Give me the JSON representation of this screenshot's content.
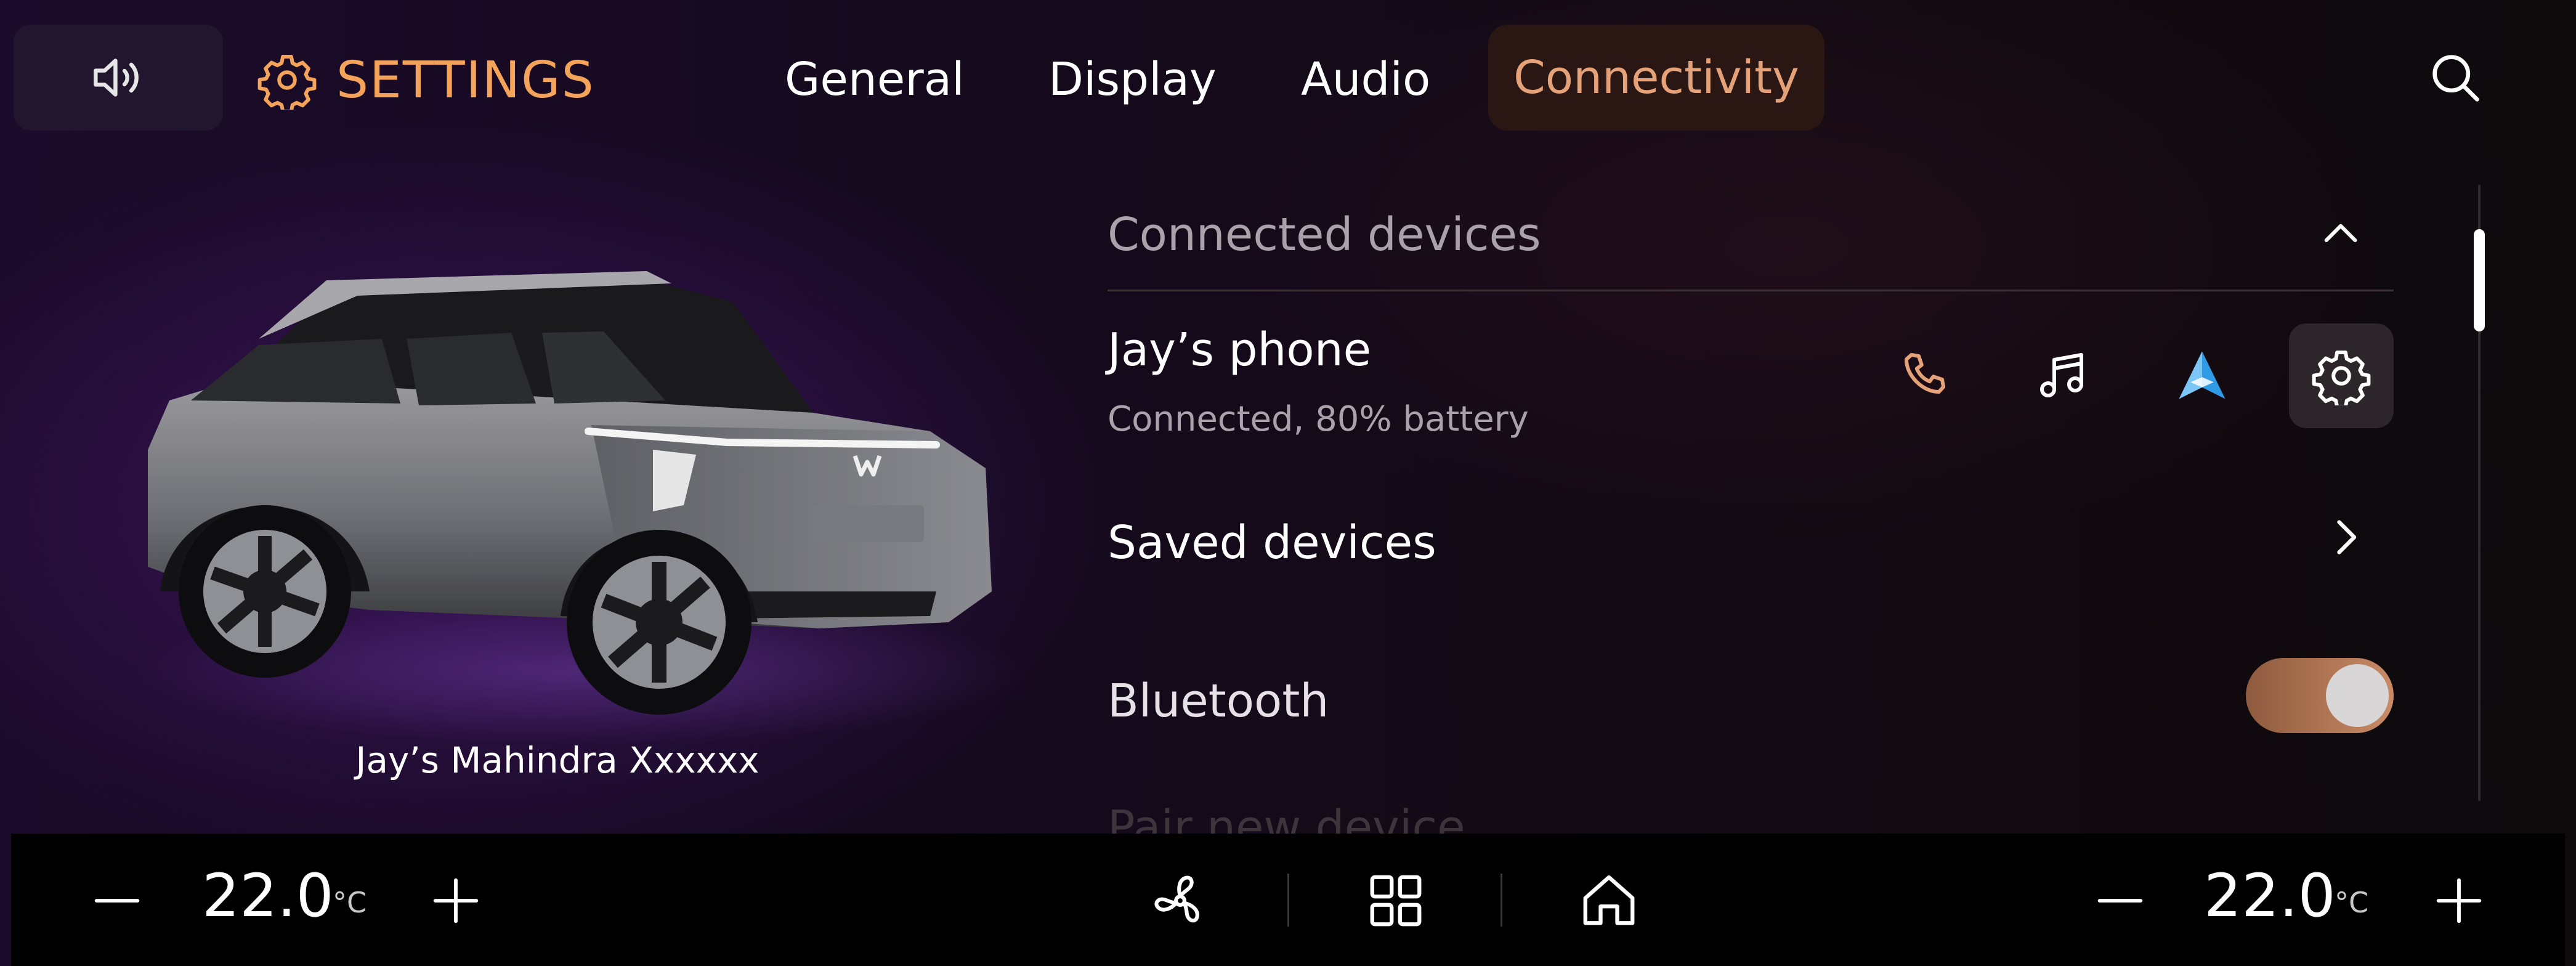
{
  "header": {
    "title": "SETTINGS",
    "tabs": [
      {
        "label": "General"
      },
      {
        "label": "Display"
      },
      {
        "label": "Audio"
      },
      {
        "label": "Connectivity",
        "active": true
      }
    ],
    "icons": {
      "volume": "volume-icon",
      "settings": "gear-icon",
      "search": "search-icon"
    }
  },
  "car": {
    "name": "Jay’s Mahindra Xxxxxx"
  },
  "connected_devices": {
    "section_title": "Connected devices",
    "device": {
      "name": "Jay’s phone",
      "status": "Connected, 80% battery",
      "actions": [
        "phone-icon",
        "music-icon",
        "android-auto-icon",
        "gear-icon"
      ]
    },
    "saved_devices_label": "Saved devices",
    "bluetooth_label": "Bluetooth",
    "bluetooth_on": true,
    "pair_new_label": "Pair new device"
  },
  "climate": {
    "left_temp": "22.0",
    "right_temp": "22.0",
    "unit": "°C"
  },
  "colors": {
    "accent_orange": "#f4a35a",
    "active_tab_text": "#e5a279",
    "toggle_on": "#c98b66",
    "android_auto_blue": "#2f9be6"
  }
}
